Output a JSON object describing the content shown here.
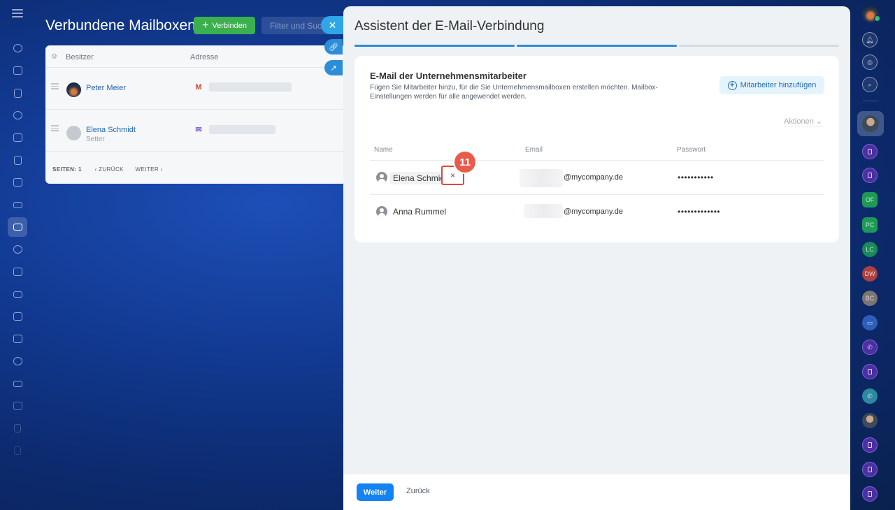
{
  "background": {
    "title": "Verbundene Mailboxen",
    "connect_button": "Verbinden",
    "filter_placeholder": "Filter und Suche",
    "table": {
      "col_owner": "Besitzer",
      "col_address": "Adresse",
      "rows": [
        {
          "name": "Peter Meier",
          "sub": "",
          "provider": "gmail-icon"
        },
        {
          "name": "Elena Schmidt",
          "sub": "Setter",
          "provider": "mail-icon"
        }
      ],
      "pager_pages_label": "SEITEN:",
      "pager_page": "1",
      "pager_prev": "ZURÜCK",
      "pager_next": "WEITER"
    }
  },
  "slider": {
    "title": "Assistent der E-Mail-Verbindung",
    "steps_total": 3,
    "steps_done": 2,
    "card": {
      "title": "E-Mail der Unternehmensmitarbeiter",
      "description": "Fügen Sie Mitarbeiter hinzu, für die Sie Unternehmensmailboxen erstellen möchten. Mailbox-Einstellungen werden für alle angewendet werden.",
      "add_button": "Mitarbeiter hinzufügen",
      "actions_label": "Aktionen",
      "columns": {
        "name": "Name",
        "email": "Email",
        "password": "Passwort"
      },
      "rows": [
        {
          "name": "Elena Schmidt",
          "email_suffix": "@mycompany.de",
          "password": "•••••••••••"
        },
        {
          "name": "Anna Rummel",
          "email_suffix": "@mycompany.de",
          "password": "•••••••••••••"
        }
      ],
      "delete_symbol": "×",
      "marker_number": "11"
    },
    "footer": {
      "next": "Weiter",
      "back": "Zurück"
    }
  },
  "right_rail": {
    "avatars": [
      "OF",
      "PC",
      "LC",
      "DW",
      "BC"
    ]
  },
  "colors": {
    "accent": "#1482f0",
    "connect_green": "#3bb04e",
    "marker_red": "#e85b4a",
    "link_blue": "#2067b0"
  }
}
